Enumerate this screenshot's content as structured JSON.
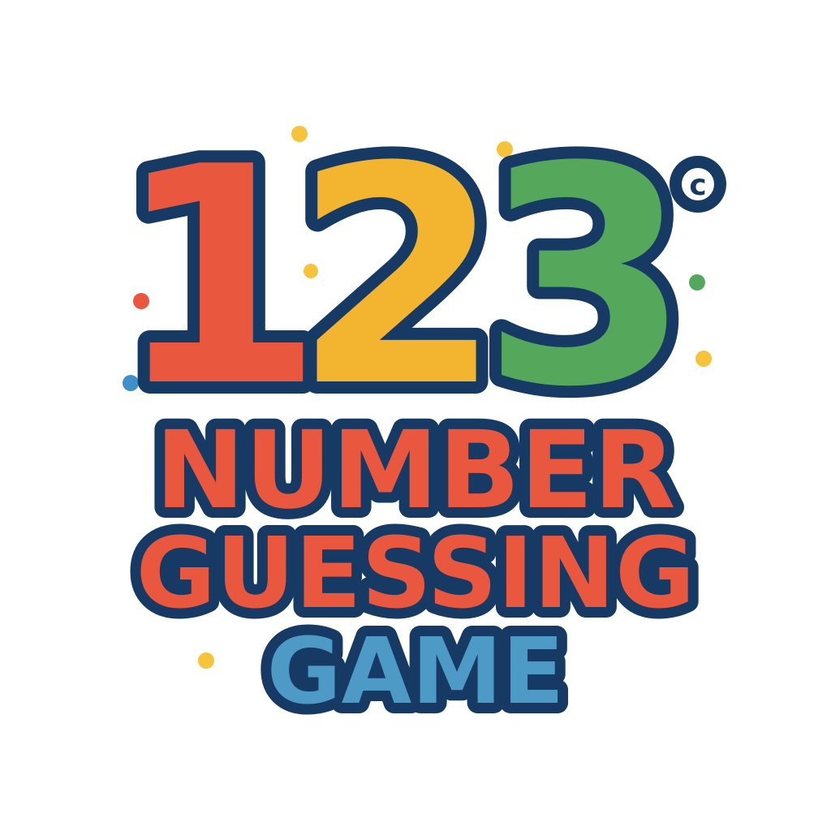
{
  "logo": {
    "digits": [
      "1",
      "2",
      "3"
    ],
    "degree_symbol": "c",
    "line1": "NUMBER",
    "line2": "GUESSING",
    "line3": "GAME"
  },
  "colors": {
    "outline": "#163a63",
    "digit_1": "#e9573f",
    "digit_2": "#f3b52f",
    "digit_3": "#55a75c",
    "title_red": "#e9573f",
    "title_blue": "#4d9ac6",
    "confetti_yellow": "#f6c33b",
    "confetti_red": "#e9573f",
    "confetti_blue": "#3f8fcb",
    "confetti_green": "#55a75c"
  },
  "decorations": {
    "confetti_dots": [
      "yellow",
      "yellow",
      "yellow",
      "red",
      "blue",
      "green",
      "yellow",
      "yellow"
    ]
  }
}
